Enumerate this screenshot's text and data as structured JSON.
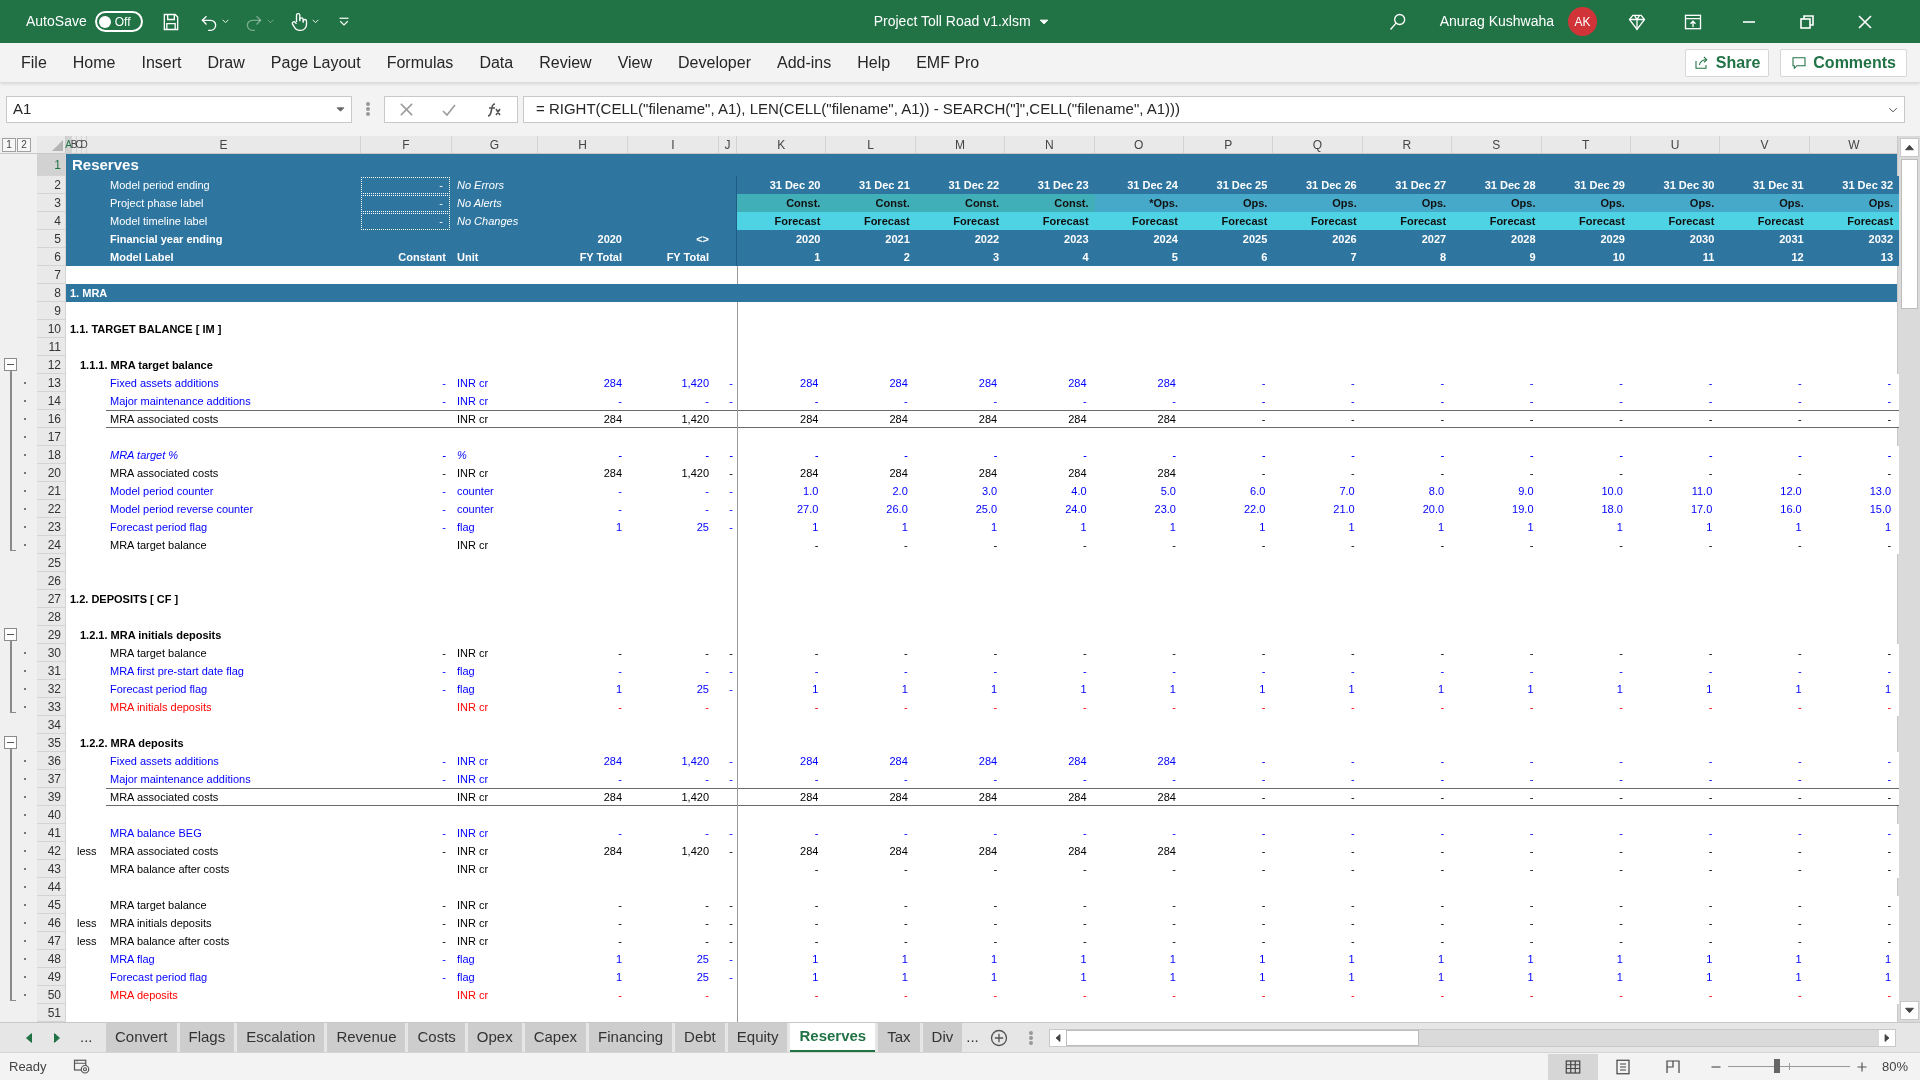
{
  "title_bar": {
    "autosave_label": "AutoSave",
    "autosave": {
      "label": "Off",
      "on": false
    },
    "redo": {
      "disabled": true
    },
    "file_title": "Project Toll Road v1.xlsm",
    "user": "Anurag Kushwaha",
    "avatar": "AK"
  },
  "ribbon_tabs": [
    "File",
    "Home",
    "Insert",
    "Draw",
    "Page Layout",
    "Formulas",
    "Data",
    "Review",
    "View",
    "Developer",
    "Add-ins",
    "Help",
    "EMF Pro"
  ],
  "share": "Share",
  "comments": "Comments",
  "name_box": "A1",
  "formula": "= RIGHT(CELL(\"filename\", A1), LEN(CELL(\"filename\", A1)) - SEARCH(\"]\",CELL(\"filename\", A1)))",
  "outline_levels": [
    "1",
    "2"
  ],
  "columns": [
    "A",
    "B",
    "C",
    "D",
    "E",
    "F",
    "G",
    "H",
    "I",
    "J",
    "K",
    "L",
    "M",
    "N",
    "O",
    "P",
    "Q",
    "R",
    "S",
    "T",
    "U",
    "V",
    "W"
  ],
  "header": {
    "num": "1",
    "title": "Reserves",
    "rows": [
      {
        "num": "2",
        "kind": "dates",
        "label": "Model period ending",
        "field": "-",
        "status": "No Errors",
        "cells": [
          "31 Dec 20",
          "31 Dec 21",
          "31 Dec 22",
          "31 Dec 23",
          "31 Dec 24",
          "31 Dec 25",
          "31 Dec 26",
          "31 Dec 27",
          "31 Dec 28",
          "31 Dec 29",
          "31 Dec 30",
          "31 Dec 31",
          "31 Dec 32"
        ]
      },
      {
        "num": "3",
        "kind": "phase",
        "label": "Project phase label",
        "field": "-",
        "status": "No Alerts",
        "cells": [
          {
            "text": "Const.",
            "color": "#41afb8"
          },
          {
            "text": "Const.",
            "color": "#41afb8"
          },
          {
            "text": "Const.",
            "color": "#41afb8"
          },
          {
            "text": "Const.",
            "color": "#41afb8"
          },
          {
            "text": "*Ops.",
            "color": "#47a9c9"
          },
          {
            "text": "Ops.",
            "color": "#47a9c9"
          },
          {
            "text": "Ops.",
            "color": "#47a9c9"
          },
          {
            "text": "Ops.",
            "color": "#47a9c9"
          },
          {
            "text": "Ops.",
            "color": "#47a9c9"
          },
          {
            "text": "Ops.",
            "color": "#47a9c9"
          },
          {
            "text": "Ops.",
            "color": "#47a9c9"
          },
          {
            "text": "Ops.",
            "color": "#47a9c9"
          },
          {
            "text": "Ops.",
            "color": "#47a9c9"
          }
        ]
      },
      {
        "num": "4",
        "kind": "timeline",
        "label": "Model timeline label",
        "field": "-",
        "status": "No Changes",
        "cells": [
          "Forecast",
          "Forecast",
          "Forecast",
          "Forecast",
          "Forecast",
          "Forecast",
          "Forecast",
          "Forecast",
          "Forecast",
          "Forecast",
          "Forecast",
          "Forecast",
          "Forecast"
        ]
      },
      {
        "num": "5",
        "kind": "years",
        "label": "Financial year ending",
        "h": "2020",
        "i": "<>",
        "cells": [
          "2020",
          "2021",
          "2022",
          "2023",
          "2024",
          "2025",
          "2026",
          "2027",
          "2028",
          "2029",
          "2030",
          "2031",
          "2032"
        ]
      },
      {
        "num": "6",
        "kind": "labels",
        "label": "Model Label",
        "f": "Constant",
        "g": "Unit",
        "h": "FY Total",
        "i": "FY Total",
        "cells": [
          "1",
          "2",
          "3",
          "4",
          "5",
          "6",
          "7",
          "8",
          "9",
          "10",
          "11",
          "12",
          "13"
        ]
      }
    ]
  },
  "rows": [
    {
      "num": "7",
      "kind": "blank"
    },
    {
      "num": "8",
      "kind": "section_bar",
      "label": "1. MRA"
    },
    {
      "num": "9",
      "kind": "blank"
    },
    {
      "num": "10",
      "kind": "heading",
      "label": "1.1. TARGET BALANCE [ IM ]"
    },
    {
      "num": "11",
      "kind": "blank"
    },
    {
      "num": "12",
      "kind": "subheading",
      "label": "1.1.1. MRA target balance",
      "expanded": true,
      "children": [
        {
          "num": "13",
          "kind": "input",
          "label": "Fixed assets additions",
          "constant": "-",
          "unit": "INR cr",
          "h": "284",
          "i": "1,420",
          "j": "-",
          "values": [
            "284",
            "284",
            "284",
            "284",
            "284",
            "-",
            "-",
            "-",
            "-",
            "-",
            "-",
            "-",
            "-"
          ]
        },
        {
          "num": "14",
          "kind": "input",
          "label": "Major maintenance additions",
          "constant": "-",
          "unit": "INR cr",
          "h": "-",
          "i": "-",
          "j": "-",
          "values": [
            "-",
            "-",
            "-",
            "-",
            "-",
            "-",
            "-",
            "-",
            "-",
            "-",
            "-",
            "-",
            "-"
          ]
        },
        {
          "num": "16",
          "kind": "total",
          "label": "MRA associated costs",
          "unit": "INR cr",
          "h": "284",
          "i": "1,420",
          "values": [
            "284",
            "284",
            "284",
            "284",
            "284",
            "-",
            "-",
            "-",
            "-",
            "-",
            "-",
            "-",
            "-"
          ]
        },
        {
          "num": "17",
          "kind": "blank"
        },
        {
          "num": "18",
          "kind": "input_pct",
          "label": "MRA target %",
          "constant": "-",
          "unit": "%",
          "h": "-",
          "i": "-",
          "j": "-",
          "values": [
            "-",
            "-",
            "-",
            "-",
            "-",
            "-",
            "-",
            "-",
            "-",
            "-",
            "-",
            "-",
            "-"
          ]
        },
        {
          "num": "20",
          "kind": "calc",
          "label": "MRA associated costs",
          "constant": "-",
          "unit": "INR cr",
          "h": "284",
          "i": "1,420",
          "j": "-",
          "values": [
            "284",
            "284",
            "284",
            "284",
            "284",
            "-",
            "-",
            "-",
            "-",
            "-",
            "-",
            "-",
            "-"
          ]
        },
        {
          "num": "21",
          "kind": "input",
          "label": "Model period counter",
          "constant": "-",
          "unit": "counter",
          "h": "-",
          "i": "-",
          "j": "-",
          "values": [
            "1.0",
            "2.0",
            "3.0",
            "4.0",
            "5.0",
            "6.0",
            "7.0",
            "8.0",
            "9.0",
            "10.0",
            "11.0",
            "12.0",
            "13.0"
          ]
        },
        {
          "num": "22",
          "kind": "input",
          "label": "Model period reverse counter",
          "constant": "-",
          "unit": "counter",
          "h": "-",
          "i": "-",
          "j": "-",
          "values": [
            "27.0",
            "26.0",
            "25.0",
            "24.0",
            "23.0",
            "22.0",
            "21.0",
            "20.0",
            "19.0",
            "18.0",
            "17.0",
            "16.0",
            "15.0"
          ]
        },
        {
          "num": "23",
          "kind": "input",
          "label": "Forecast period flag",
          "constant": "-",
          "unit": "flag",
          "h": "1",
          "i": "25",
          "j": "-",
          "values": [
            "1",
            "1",
            "1",
            "1",
            "1",
            "1",
            "1",
            "1",
            "1",
            "1",
            "1",
            "1",
            "1"
          ]
        },
        {
          "num": "24",
          "kind": "calc",
          "label": "MRA target balance",
          "unit": "INR cr",
          "values": [
            "-",
            "-",
            "-",
            "-",
            "-",
            "-",
            "-",
            "-",
            "-",
            "-",
            "-",
            "-",
            "-"
          ]
        }
      ]
    },
    {
      "num": "25",
      "kind": "blank"
    },
    {
      "num": "26",
      "kind": "blank"
    },
    {
      "num": "27",
      "kind": "heading",
      "label": "1.2. DEPOSITS [ CF ]"
    },
    {
      "num": "28",
      "kind": "blank"
    },
    {
      "num": "29",
      "kind": "subheading",
      "label": "1.2.1. MRA initials deposits",
      "expanded": true,
      "children": [
        {
          "num": "30",
          "kind": "calc",
          "label": "MRA target balance",
          "constant": "-",
          "unit": "INR cr",
          "h": "-",
          "i": "-",
          "j": "-",
          "values": [
            "-",
            "-",
            "-",
            "-",
            "-",
            "-",
            "-",
            "-",
            "-",
            "-",
            "-",
            "-",
            "-"
          ]
        },
        {
          "num": "31",
          "kind": "input",
          "label": "MRA first pre-start date flag",
          "constant": "-",
          "unit": "flag",
          "h": "-",
          "i": "-",
          "j": "-",
          "values": [
            "-",
            "-",
            "-",
            "-",
            "-",
            "-",
            "-",
            "-",
            "-",
            "-",
            "-",
            "-",
            "-"
          ]
        },
        {
          "num": "32",
          "kind": "input",
          "label": "Forecast period flag",
          "constant": "-",
          "unit": "flag",
          "h": "1",
          "i": "25",
          "j": "-",
          "values": [
            "1",
            "1",
            "1",
            "1",
            "1",
            "1",
            "1",
            "1",
            "1",
            "1",
            "1",
            "1",
            "1"
          ]
        },
        {
          "num": "33",
          "kind": "output",
          "label": "MRA initials deposits",
          "unit": "INR cr",
          "h": "-",
          "i": "-",
          "values": [
            "-",
            "-",
            "-",
            "-",
            "-",
            "-",
            "-",
            "-",
            "-",
            "-",
            "-",
            "-",
            "-"
          ]
        }
      ]
    },
    {
      "num": "34",
      "kind": "blank"
    },
    {
      "num": "35",
      "kind": "subheading",
      "label": "1.2.2. MRA deposits",
      "expanded": true,
      "children": [
        {
          "num": "36",
          "kind": "input",
          "label": "Fixed assets additions",
          "constant": "-",
          "unit": "INR cr",
          "h": "284",
          "i": "1,420",
          "j": "-",
          "values": [
            "284",
            "284",
            "284",
            "284",
            "284",
            "-",
            "-",
            "-",
            "-",
            "-",
            "-",
            "-",
            "-"
          ]
        },
        {
          "num": "37",
          "kind": "input",
          "label": "Major maintenance additions",
          "constant": "-",
          "unit": "INR cr",
          "h": "-",
          "i": "-",
          "j": "-",
          "values": [
            "-",
            "-",
            "-",
            "-",
            "-",
            "-",
            "-",
            "-",
            "-",
            "-",
            "-",
            "-",
            "-"
          ]
        },
        {
          "num": "39",
          "kind": "total",
          "label": "MRA associated costs",
          "unit": "INR cr",
          "h": "284",
          "i": "1,420",
          "values": [
            "284",
            "284",
            "284",
            "284",
            "284",
            "-",
            "-",
            "-",
            "-",
            "-",
            "-",
            "-",
            "-"
          ]
        },
        {
          "num": "40",
          "kind": "blank"
        },
        {
          "num": "41",
          "kind": "input",
          "label": "MRA balance BEG",
          "constant": "-",
          "unit": "INR cr",
          "h": "-",
          "i": "-",
          "j": "-",
          "values": [
            "-",
            "-",
            "-",
            "-",
            "-",
            "-",
            "-",
            "-",
            "-",
            "-",
            "-",
            "-",
            "-"
          ]
        },
        {
          "num": "42",
          "kind": "calc",
          "prefix": "less",
          "label": "MRA associated costs",
          "constant": "-",
          "unit": "INR cr",
          "h": "284",
          "i": "1,420",
          "j": "-",
          "values": [
            "284",
            "284",
            "284",
            "284",
            "284",
            "-",
            "-",
            "-",
            "-",
            "-",
            "-",
            "-",
            "-"
          ]
        },
        {
          "num": "43",
          "kind": "calc",
          "label": "MRA balance after costs",
          "unit": "INR cr",
          "values": [
            "-",
            "-",
            "-",
            "-",
            "-",
            "-",
            "-",
            "-",
            "-",
            "-",
            "-",
            "-",
            "-"
          ]
        },
        {
          "num": "44",
          "kind": "blank"
        },
        {
          "num": "45",
          "kind": "calc",
          "label": "MRA target balance",
          "constant": "-",
          "unit": "INR cr",
          "h": "-",
          "i": "-",
          "j": "-",
          "values": [
            "-",
            "-",
            "-",
            "-",
            "-",
            "-",
            "-",
            "-",
            "-",
            "-",
            "-",
            "-",
            "-"
          ]
        },
        {
          "num": "46",
          "kind": "calc",
          "prefix": "less",
          "label": "MRA initials deposits",
          "constant": "-",
          "unit": "INR cr",
          "h": "-",
          "i": "-",
          "j": "-",
          "values": [
            "-",
            "-",
            "-",
            "-",
            "-",
            "-",
            "-",
            "-",
            "-",
            "-",
            "-",
            "-",
            "-"
          ]
        },
        {
          "num": "47",
          "kind": "calc",
          "prefix": "less",
          "label": "MRA balance after costs",
          "constant": "-",
          "unit": "INR cr",
          "h": "-",
          "i": "-",
          "j": "-",
          "values": [
            "-",
            "-",
            "-",
            "-",
            "-",
            "-",
            "-",
            "-",
            "-",
            "-",
            "-",
            "-",
            "-"
          ]
        },
        {
          "num": "48",
          "kind": "input",
          "label": "MRA flag",
          "constant": "-",
          "unit": "flag",
          "h": "1",
          "i": "25",
          "j": "-",
          "values": [
            "1",
            "1",
            "1",
            "1",
            "1",
            "1",
            "1",
            "1",
            "1",
            "1",
            "1",
            "1",
            "1"
          ]
        },
        {
          "num": "49",
          "kind": "input",
          "label": "Forecast period flag",
          "constant": "-",
          "unit": "flag",
          "h": "1",
          "i": "25",
          "j": "-",
          "values": [
            "1",
            "1",
            "1",
            "1",
            "1",
            "1",
            "1",
            "1",
            "1",
            "1",
            "1",
            "1",
            "1"
          ]
        },
        {
          "num": "50",
          "kind": "output",
          "label": "MRA deposits",
          "unit": "INR cr",
          "h": "-",
          "i": "-",
          "values": [
            "-",
            "-",
            "-",
            "-",
            "-",
            "-",
            "-",
            "-",
            "-",
            "-",
            "-",
            "-",
            "-"
          ]
        }
      ]
    },
    {
      "num": "51",
      "kind": "blank"
    }
  ],
  "sheet_nav_more": "...",
  "sheet_tabs": [
    {
      "label": "Convert",
      "selected": false
    },
    {
      "label": "Flags",
      "selected": false
    },
    {
      "label": "Escalation",
      "selected": false
    },
    {
      "label": "Revenue",
      "selected": false
    },
    {
      "label": "Costs",
      "selected": false
    },
    {
      "label": "Opex",
      "selected": false
    },
    {
      "label": "Capex",
      "selected": false
    },
    {
      "label": "Financing",
      "selected": false
    },
    {
      "label": "Debt",
      "selected": false
    },
    {
      "label": "Equity",
      "selected": false
    },
    {
      "label": "Reserves",
      "selected": true
    },
    {
      "label": "Tax",
      "selected": false
    },
    {
      "label": "Div",
      "selected": false
    }
  ],
  "sheet_tabs_more": "...",
  "status": "Ready",
  "views": [
    {
      "kind": "normal",
      "selected": true
    },
    {
      "kind": "page_layout",
      "selected": false
    },
    {
      "kind": "page_break",
      "selected": false
    }
  ],
  "zoom": {
    "level": 0.4,
    "reading": "80%"
  }
}
